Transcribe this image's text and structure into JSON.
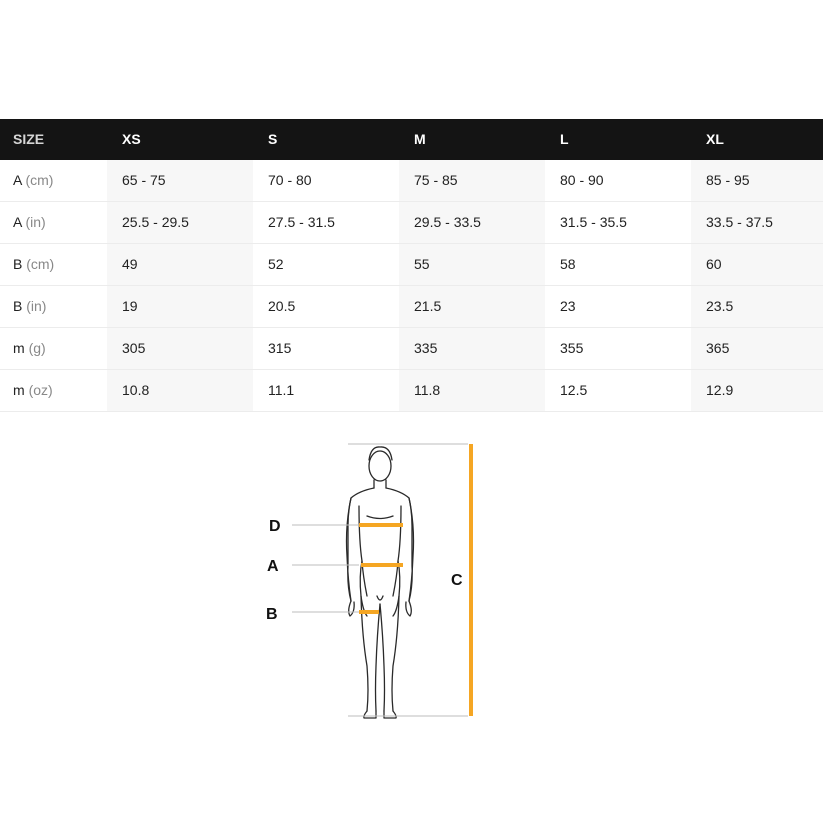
{
  "table": {
    "header": [
      "SIZE",
      "XS",
      "S",
      "M",
      "L",
      "XL"
    ],
    "rows": [
      {
        "label": "A",
        "unit": "(cm)",
        "values": [
          "65 - 75",
          "70 - 80",
          "75 - 85",
          "80 - 90",
          "85 - 95"
        ]
      },
      {
        "label": "A",
        "unit": "(in)",
        "values": [
          "25.5 - 29.5",
          "27.5 - 31.5",
          "29.5 - 33.5",
          "31.5 - 35.5",
          "33.5 - 37.5"
        ]
      },
      {
        "label": "B",
        "unit": "(cm)",
        "values": [
          "49",
          "52",
          "55",
          "58",
          "60"
        ]
      },
      {
        "label": "B",
        "unit": "(in)",
        "values": [
          "19",
          "20.5",
          "21.5",
          "23",
          "23.5"
        ]
      },
      {
        "label": "m",
        "unit": "(g)",
        "values": [
          "305",
          "315",
          "335",
          "355",
          "365"
        ]
      },
      {
        "label": "m",
        "unit": "(oz)",
        "values": [
          "10.8",
          "11.1",
          "11.8",
          "12.5",
          "12.9"
        ]
      }
    ]
  },
  "diagram": {
    "labels": {
      "D": "D",
      "A": "A",
      "B": "B",
      "C": "C"
    },
    "icon": "human-figure-measurement-diagram",
    "accent_color": "#f5a623"
  }
}
